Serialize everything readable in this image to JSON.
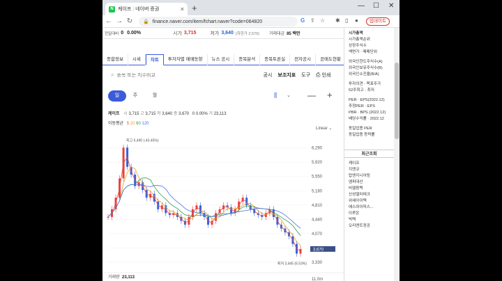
{
  "browser": {
    "tab_title": "케이프 : 네이버 증권",
    "url": "finance.naver.com/item/fchart.naver?code=064820",
    "update_label": "업데이트"
  },
  "pricebar": {
    "change_label": "전일대비",
    "change_value": "0",
    "change_pct": "0.00%",
    "high_label": "시가",
    "high_value": "3,715",
    "low_label": "저가",
    "low_value": "3,640",
    "low_limit": "(하한가 2,570)",
    "volume_label": "거래대금",
    "volume_value": "85 백만"
  },
  "menu": [
    "종합정보",
    "시세",
    "차트",
    "투자자별 매매동향",
    "뉴스 공시",
    "종목분석",
    "종목토론실",
    "전자공시",
    "공매도현황"
  ],
  "search": {
    "placeholder": "종목 또는 지수비교",
    "links": [
      "공시",
      "보조지표",
      "도구",
      "인쇄"
    ]
  },
  "period": {
    "day": "일",
    "week": "주",
    "month": "월"
  },
  "info": {
    "name": "케이프",
    "open_label": "시",
    "open": "3,715",
    "high_label": "고",
    "high": "3,715",
    "low_label": "저",
    "low": "3,640",
    "close_label": "종",
    "close": "3,670",
    "change": "0",
    "pct": "0.00%",
    "vol_label": "거",
    "vol": "23,113",
    "ma_label": "이동평균",
    "ma": [
      "5",
      "20",
      "60",
      "120"
    ],
    "scale": "Linear"
  },
  "chart_data": {
    "type": "line",
    "title": "",
    "y_ticks": [
      "6,290",
      "5,920",
      "5,550",
      "5,180",
      "4,810",
      "4,440",
      "4,070",
      "3,700",
      "3,330"
    ],
    "ylim": [
      3200,
      6700
    ],
    "max_label": "최고 6,490 (-43.45%)",
    "min_label": "최저 3,445 (6.53%)",
    "last_label": "3,670",
    "volume_label": "거래량",
    "volume_value": "23,113",
    "volume_axis": "11.0m",
    "series": [
      {
        "name": "5",
        "color": "#e84a4a"
      },
      {
        "name": "20",
        "color": "#f0a020"
      },
      {
        "name": "60",
        "color": "#2e9e4a"
      },
      {
        "name": "120",
        "color": "#4a6ee8"
      }
    ],
    "x": [
      0,
      2,
      4,
      6,
      8,
      10,
      12,
      14,
      16,
      18,
      20,
      22,
      24,
      26,
      28,
      30,
      32,
      34,
      36,
      38,
      40,
      42,
      44,
      46,
      48,
      50,
      52,
      54,
      56,
      58,
      60,
      62,
      64,
      66,
      68,
      70,
      72,
      74,
      76,
      78,
      80,
      82,
      84,
      86,
      88,
      90,
      92,
      94,
      96,
      98,
      100
    ],
    "close": [
      4500,
      4700,
      5000,
      5500,
      6300,
      5800,
      5600,
      5300,
      5400,
      5200,
      5000,
      5100,
      4900,
      4700,
      4800,
      4600,
      4550,
      4600,
      4500,
      4400,
      4300,
      4500,
      4700,
      4800,
      4600,
      4500,
      4300,
      4400,
      4600,
      4700,
      4800,
      4750,
      4600,
      4700,
      4900,
      5000,
      4800,
      4700,
      4600,
      4550,
      4500,
      4600,
      4700,
      4500,
      4300,
      4200,
      4100,
      4000,
      3800,
      3550,
      3670
    ]
  },
  "right": {
    "block1": [
      "시가총액",
      "시가총액순위",
      "상장주식수",
      "액면가 · 매매단위"
    ],
    "block2": [
      "외국인한도주식수(A)",
      "외국인보유주식수(B)",
      "외국인소진율(B/A)"
    ],
    "block3": [
      "투자의견 · 목표주가",
      "52주최고 · 최저"
    ],
    "block4": [
      "PER · EPS(2022.12)",
      "추정PER · EPS",
      "PBR · BPS (2022.12)",
      "배당수익률 · 2022.12"
    ],
    "block5": [
      "동일업종 PER",
      "동일업종 등락률"
    ],
    "recent_title": "최근조회",
    "recent": [
      "케이프",
      "지엔코",
      "탑엔지니어링",
      "엠피대산",
      "비엘팜텍",
      "신성델타테크",
      "위세아이텍",
      "에스와이피스...",
      "이루온",
      "빅텍",
      "오리엔트정공"
    ]
  }
}
